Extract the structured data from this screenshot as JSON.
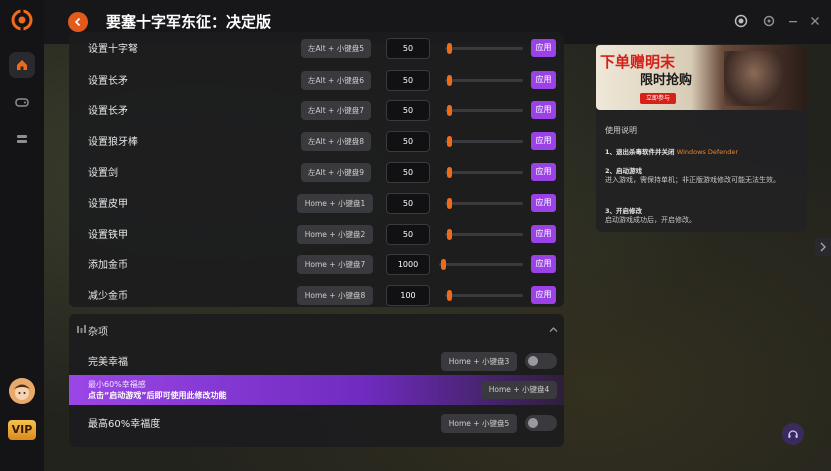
{
  "app": {
    "title": "要塞十字军东征：决定版"
  },
  "cheats": [
    {
      "label": "设置十字弩",
      "hotkey": "左Alt + 小键盘5",
      "value": "50",
      "apply": "应用"
    },
    {
      "label": "设置长矛",
      "hotkey": "左Alt + 小键盘6",
      "value": "50",
      "apply": "应用"
    },
    {
      "label": "设置长矛",
      "hotkey": "左Alt + 小键盘7",
      "value": "50",
      "apply": "应用"
    },
    {
      "label": "设置狼牙棒",
      "hotkey": "左Alt + 小键盘8",
      "value": "50",
      "apply": "应用"
    },
    {
      "label": "设置剑",
      "hotkey": "左Alt + 小键盘9",
      "value": "50",
      "apply": "应用"
    },
    {
      "label": "设置皮甲",
      "hotkey": "Home + 小键盘1",
      "value": "50",
      "apply": "应用"
    },
    {
      "label": "设置铁甲",
      "hotkey": "Home + 小键盘2",
      "value": "50",
      "apply": "应用"
    },
    {
      "label": "添加金币",
      "hotkey": "Home + 小键盘7",
      "value": "1000",
      "apply": "应用"
    },
    {
      "label": "减少金币",
      "hotkey": "Home + 小键盘8",
      "value": "100",
      "apply": "应用"
    }
  ],
  "misc": {
    "title": "杂项",
    "items": [
      {
        "label": "完美幸福",
        "hotkey": "Home + 小键盘3"
      },
      {
        "label": "最小60%幸福感",
        "hotkey": "Home + 小键盘4",
        "notice": "点击“启动游戏”后即可使用此修改功能"
      },
      {
        "label": "最高60%幸福度",
        "hotkey": "Home + 小键盘5"
      }
    ]
  },
  "banner": {
    "line1": "下单赠明末",
    "line2": "限时抢购",
    "button": "立即参与"
  },
  "instructions": {
    "title": "使用说明",
    "step1_title": "1、退出杀毒软件并关闭",
    "step1_highlight": "Windows Defender",
    "step2_title": "2、启动游戏",
    "step2_text": "进入游戏，需保持单机；非正版游戏修改可能无法生效。",
    "step3_title": "3、开启修改",
    "step3_text": "启动游戏成功后，开启修改。"
  },
  "sidebar": {
    "vip": "VIP"
  },
  "colors": {
    "accent_orange": "#f06a1c",
    "apply_purple": "#9a42e6",
    "highlight_orange": "#f0832a"
  },
  "sliders": [
    0.02,
    0.02,
    0.02,
    0.02,
    0.02,
    0.02,
    0.02,
    0.02,
    0.02
  ]
}
